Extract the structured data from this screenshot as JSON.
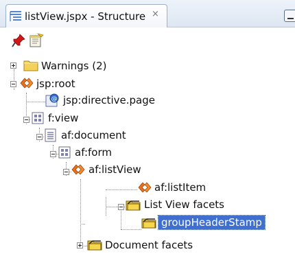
{
  "panel": {
    "tab_title": "listView.jspx - Structure",
    "close_glyph": "×",
    "icons": {
      "tab": "structure-list-icon",
      "minimize": "minimize-icon",
      "pin": "red-pushpin-icon",
      "edit": "edit-notepad-icon"
    }
  },
  "tree": [
    {
      "label": "Warnings (2)",
      "icon": "folder-icon",
      "toggle": "expand",
      "selected": false
    },
    {
      "label": "jsp:root",
      "icon": "jsp-tag-icon",
      "toggle": "collapse",
      "selected": false
    },
    {
      "label": "jsp:directive.page",
      "icon": "directive-icon",
      "toggle": "none",
      "selected": false
    },
    {
      "label": "f:view",
      "icon": "component-grid-icon",
      "toggle": "collapse",
      "selected": false
    },
    {
      "label": "af:document",
      "icon": "document-icon",
      "toggle": "collapse",
      "selected": false
    },
    {
      "label": "af:form",
      "icon": "component-grid-icon",
      "toggle": "collapse",
      "selected": false
    },
    {
      "label": "af:listView",
      "icon": "jsp-tag-icon",
      "toggle": "collapse",
      "selected": false
    },
    {
      "label": "af:listItem",
      "icon": "jsp-tag-icon",
      "toggle": "none",
      "selected": false
    },
    {
      "label": "List View facets",
      "icon": "facet-folder-icon",
      "toggle": "collapse",
      "selected": false
    },
    {
      "label": "groupHeaderStamp",
      "icon": "facet-folder-icon",
      "toggle": "none",
      "selected": true
    },
    {
      "label": "Document facets",
      "icon": "facet-folder-icon",
      "toggle": "expand",
      "selected": false
    }
  ],
  "colors": {
    "selection": "#3f6fd0",
    "tag_orange": "#e8701c",
    "folder_yellow": "#f5cf4a"
  }
}
